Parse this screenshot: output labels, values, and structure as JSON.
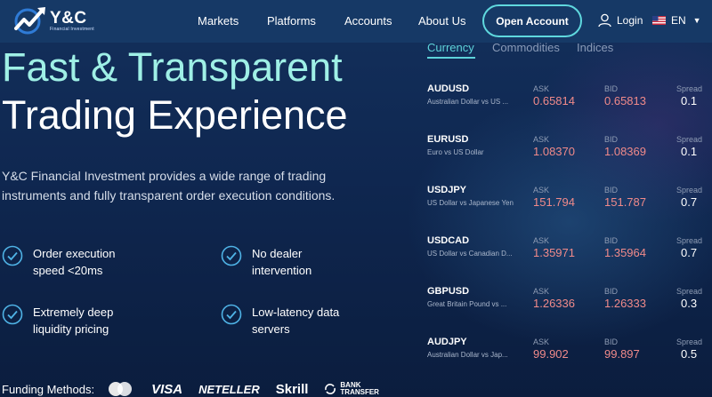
{
  "brand": {
    "name": "Y&C",
    "subtitle": "Financial Investment"
  },
  "nav": {
    "items": [
      "Markets",
      "Platforms",
      "Accounts",
      "About Us"
    ],
    "open_account": "Open Account",
    "login": "Login",
    "language": "EN"
  },
  "hero": {
    "line1": "Fast & Transparent",
    "line2": "Trading Experience",
    "description": "Y&C Financial Investment provides a wide range of trading instruments and fully transparent order execution conditions."
  },
  "features": [
    {
      "line1": "Order execution",
      "line2": "speed <20ms"
    },
    {
      "line1": "No dealer",
      "line2": "intervention"
    },
    {
      "line1": "Extremely deep",
      "line2": "liquidity pricing"
    },
    {
      "line1": "Low-latency data",
      "line2": "servers"
    }
  ],
  "funding": {
    "label": "Funding Methods:",
    "methods": [
      "VISA",
      "NETELLER",
      "Skrill",
      "BANK TRANSFER"
    ]
  },
  "quotes": {
    "tabs": [
      "Currency",
      "Commodities",
      "Indices"
    ],
    "active_tab": "Currency",
    "labels": {
      "ask": "ASK",
      "bid": "BID",
      "spread": "Spread"
    },
    "rows": [
      {
        "symbol": "AUDUSD",
        "desc": "Australian Dollar vs US ...",
        "ask": "0.65814",
        "bid": "0.65813",
        "spread": "0.1"
      },
      {
        "symbol": "EURUSD",
        "desc": "Euro vs US Dollar",
        "ask": "1.08370",
        "bid": "1.08369",
        "spread": "0.1"
      },
      {
        "symbol": "USDJPY",
        "desc": "US Dollar vs Japanese Yen",
        "ask": "151.794",
        "bid": "151.787",
        "spread": "0.7"
      },
      {
        "symbol": "USDCAD",
        "desc": "US Dollar vs Canadian D...",
        "ask": "1.35971",
        "bid": "1.35964",
        "spread": "0.7"
      },
      {
        "symbol": "GBPUSD",
        "desc": "Great Britain Pound vs ...",
        "ask": "1.26336",
        "bid": "1.26333",
        "spread": "0.3"
      },
      {
        "symbol": "AUDJPY",
        "desc": "Australian Dollar vs Jap...",
        "ask": "99.902",
        "bid": "99.897",
        "spread": "0.5"
      }
    ]
  },
  "colors": {
    "accent": "#5ed3da",
    "hero_highlight": "#9ff0e6",
    "price": "#f08a8a",
    "header": "#163966"
  }
}
